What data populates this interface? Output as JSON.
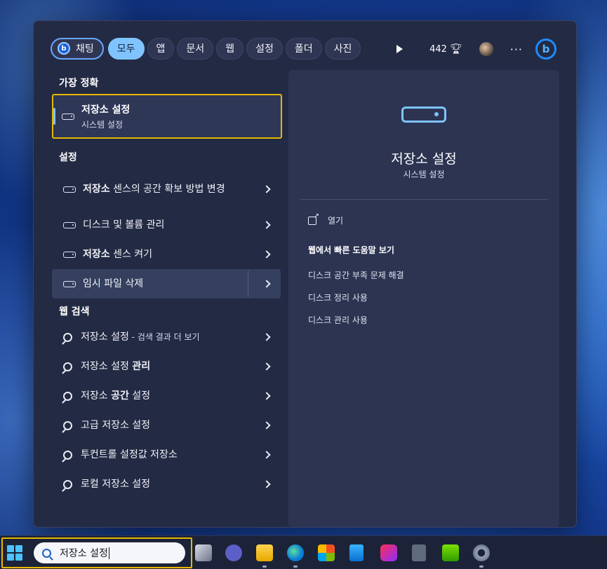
{
  "filters": {
    "chat": "채팅",
    "all": "모두",
    "apps": "앱",
    "documents": "문서",
    "web": "웹",
    "settings": "설정",
    "folders": "폴더",
    "photos": "사진",
    "points": "442"
  },
  "best_match": {
    "section_title": "가장 정확",
    "title": "저장소 설정",
    "subtitle": "시스템 설정"
  },
  "settings_section": {
    "section_title": "설정",
    "items": [
      {
        "bold": "저장소",
        "rest": " 센스의 공간 확보 방법 변경"
      },
      {
        "bold": "",
        "rest": "디스크 및 볼륨 관리"
      },
      {
        "bold": "저장소",
        "rest": " 센스 켜기"
      },
      {
        "bold": "",
        "rest": "임시 파일 삭제"
      }
    ]
  },
  "web_section": {
    "section_title": "웹 검색",
    "items": [
      {
        "bold": "",
        "rest": "저장소 설정",
        "small": " - 검색 결과 더 보기"
      },
      {
        "bold": "",
        "rest": "저장소 설정 ",
        "tail": "관리"
      },
      {
        "bold": "",
        "rest": "저장소 ",
        "tail": "공간",
        "rest2": " 설정"
      },
      {
        "bold": "",
        "rest": "고급 저장소 설정"
      },
      {
        "bold": "",
        "rest": "투컨트롤 설정값 저장소"
      },
      {
        "bold": "",
        "rest": "로컬 저장소 설정"
      }
    ]
  },
  "preview": {
    "title": "저장소 설정",
    "subtitle": "시스템 설정",
    "open_label": "열기",
    "help_title": "웹에서 빠른 도움말 보기",
    "help_links": [
      "디스크 공간 부족 문제 해결",
      "디스크 정리 사용",
      "디스크 관리 사용"
    ]
  },
  "taskbar": {
    "search_text": "저장소 설정"
  },
  "colors": {
    "accent": "#7fc4ff",
    "highlight_box": "#e6b800"
  }
}
